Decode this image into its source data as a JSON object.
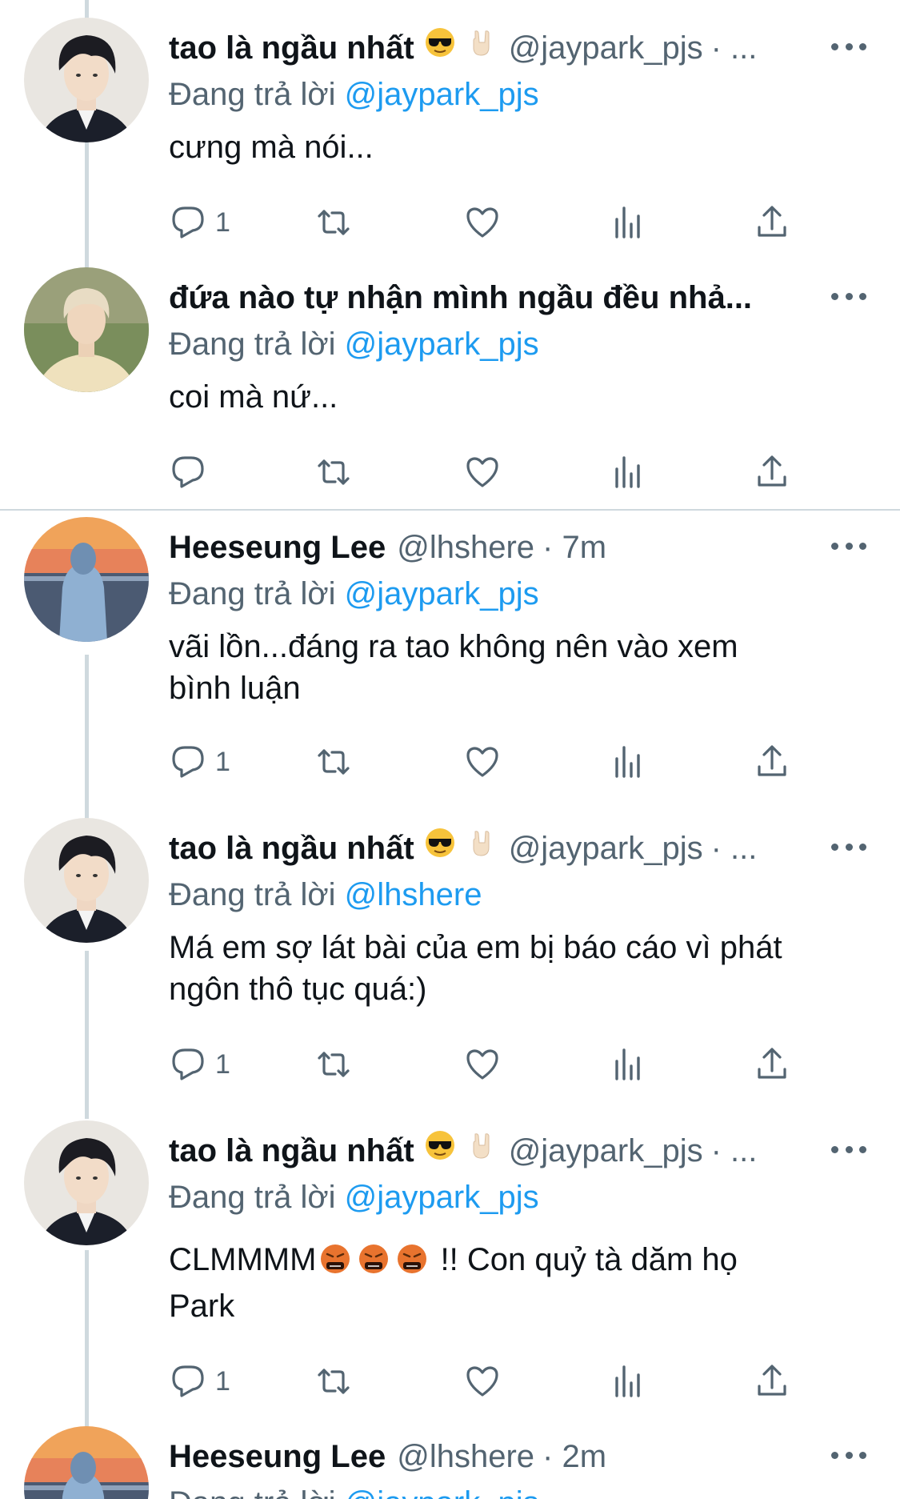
{
  "replying_prefix": "Đang trả lời",
  "tweets": [
    {
      "name": "tao là ngầu nhất",
      "handle": "@jaypark_pjs",
      "meta": "· ...",
      "reply_to": "@jaypark_pjs",
      "body": "cưng mà nói...",
      "replies": "1"
    },
    {
      "name": "đứa nào tự nhận mình ngầu đều nhả...",
      "handle": "",
      "meta": "",
      "reply_to": "@jaypark_pjs",
      "body": "coi mà nứ...",
      "replies": ""
    },
    {
      "name": "Heeseung Lee",
      "handle": "@lhshere",
      "meta": "· 7m",
      "reply_to": "@jaypark_pjs",
      "body": "vãi lồn...đáng ra tao không nên vào xem\nbình luận",
      "replies": "1"
    },
    {
      "name": "tao là ngầu nhất",
      "handle": "@jaypark_pjs",
      "meta": "· ...",
      "reply_to": "@lhshere",
      "body": "Má em sợ lát bài của em bị báo cáo vì phát\nngôn thô tục quá:)",
      "replies": "1"
    },
    {
      "name": "tao là ngầu nhất",
      "handle": "@jaypark_pjs",
      "meta": "· ...",
      "reply_to": "@jaypark_pjs",
      "body_start": "CLMMMM",
      "body_end": " !! Con quỷ tà dăm họ\nPark",
      "replies": "1"
    },
    {
      "name": "Heeseung Lee",
      "handle": "@lhshere",
      "meta": "· 2m",
      "reply_to": "@jaypark_pjs"
    }
  ],
  "icons": {
    "reply": "speech-bubble-icon",
    "retweet": "retweet-arrows-icon",
    "like": "heart-icon",
    "views": "bar-chart-icon",
    "share": "share-upload-icon",
    "more": "more-dots-icon"
  },
  "colors": {
    "text": "#0f1419",
    "secondary": "#536471",
    "link": "#1d9bf0",
    "thread_line": "#cfd9de"
  }
}
